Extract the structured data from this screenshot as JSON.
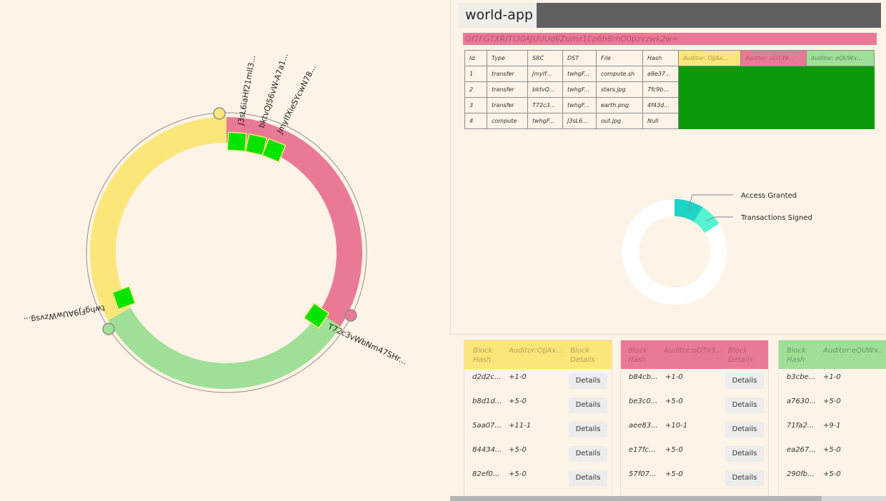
{
  "app": {
    "title": "world-app",
    "hash": "Gf7FGTXRfTI30AJUUUd6Zumz1Ep6h8rhO0pzvzwk2w="
  },
  "colors": {
    "yellow": "#fbe67a",
    "pink": "#e97a96",
    "green": "#9fdf97",
    "signed_green": "#0b9a0b",
    "block_green": "#00e400",
    "teal": "#1fd3c6",
    "teal_light": "#54f3d3"
  },
  "ring": {
    "nodes": [
      {
        "label": "J3sL6iaHf21mIl3...",
        "color": "yellow"
      },
      {
        "label": "twhgFJ9AUwWzvsg...",
        "color": "green"
      },
      {
        "label": "T72c3vWbNm47SHr...",
        "color": "pink"
      }
    ],
    "tx_labels": [
      "bktvQJ56vW-A7a1...",
      "JmyIfXieSYcwN78..."
    ]
  },
  "table": {
    "headers": [
      "Id",
      "Type",
      "SRC",
      "DST",
      "File",
      "Hash",
      "Auditor: OJjAx...",
      "Auditor: oOT49...",
      "Auditor: eQUWx..."
    ],
    "rows": [
      [
        "1",
        "transfer",
        "JmyIf...",
        "twhgF...",
        "compute.sh",
        "a9e37..."
      ],
      [
        "2",
        "transfer",
        "bktvQ...",
        "twhgF...",
        "stars.jpg",
        "7fc9b..."
      ],
      [
        "3",
        "transfer",
        "T72c3...",
        "twhgF...",
        "earth.png",
        "4f43d..."
      ],
      [
        "4",
        "compute",
        "twhgF...",
        "J3sL6...",
        "out.jpg",
        "Null"
      ]
    ]
  },
  "donut": {
    "labels": [
      "Access Granted",
      "Transactions Signed"
    ],
    "values": [
      0.09,
      0.07
    ]
  },
  "blocks": {
    "col1": "Block Hash",
    "col3": "Block Details",
    "button": "Details",
    "cards": [
      {
        "auditor": "Auditor:OJjAx...",
        "rows": [
          [
            "d2d2c...",
            "+1-0"
          ],
          [
            "b8d1d...",
            "+5-0"
          ],
          [
            "5aa07...",
            "+11-1"
          ],
          [
            "84434...",
            "+5-0"
          ],
          [
            "82ef0...",
            "+5-0"
          ]
        ]
      },
      {
        "auditor": "Auditor:oOT49...",
        "rows": [
          [
            "b84cb...",
            "+1-0"
          ],
          [
            "be3c0...",
            "+5-0"
          ],
          [
            "aee83...",
            "+10-1"
          ],
          [
            "e17fc...",
            "+5-0"
          ],
          [
            "57f07...",
            "+5-0"
          ]
        ]
      },
      {
        "auditor": "Auditor:eQUWx...",
        "rows": [
          [
            "b3cbe...",
            "+1-0"
          ],
          [
            "a7630...",
            "+5-0"
          ],
          [
            "71fa2...",
            "+9-1"
          ],
          [
            "ea267...",
            "+5-0"
          ],
          [
            "290fb...",
            "+5-0"
          ]
        ]
      }
    ]
  }
}
